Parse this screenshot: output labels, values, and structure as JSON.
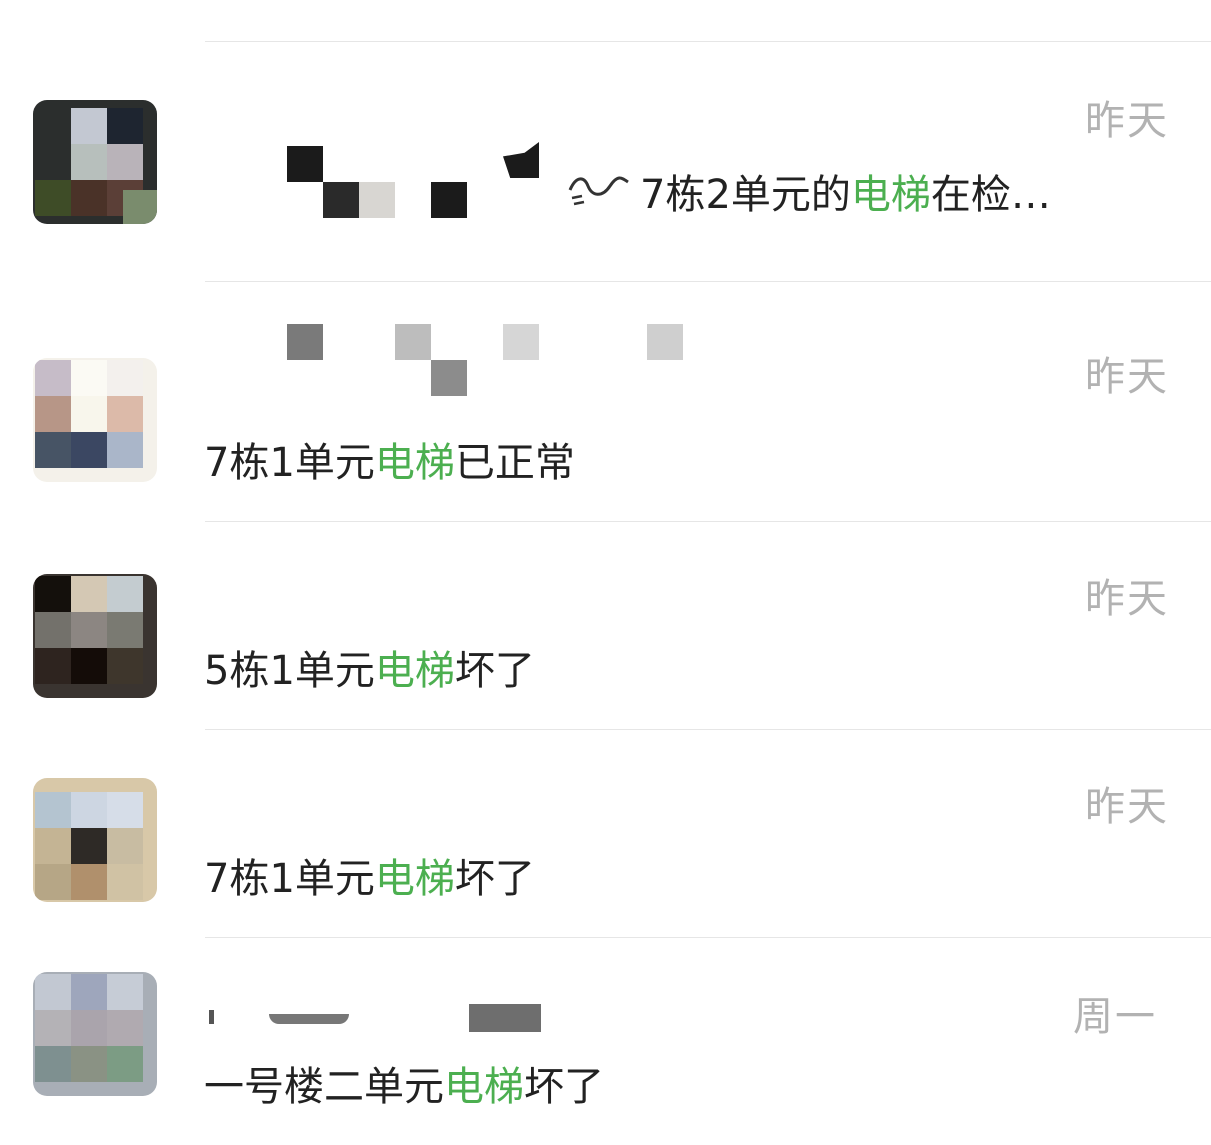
{
  "colors": {
    "keyword": "#4caf50",
    "time": "#b2b2b2",
    "text": "#222222"
  },
  "results": [
    {
      "time": "昨天",
      "preview_pre": "7栋2单元的",
      "keyword": "电梯",
      "preview_post": "在检…"
    },
    {
      "time": "昨天",
      "preview_pre": "7栋1单元",
      "keyword": "电梯",
      "preview_post": "已正常"
    },
    {
      "time": "昨天",
      "preview_pre": "5栋1单元",
      "keyword": "电梯",
      "preview_post": "坏了"
    },
    {
      "time": "昨天",
      "preview_pre": "7栋1单元",
      "keyword": "电梯",
      "preview_post": "坏了"
    },
    {
      "time": "周一",
      "preview_pre": "一号楼二单元",
      "keyword": "电梯",
      "preview_post": "坏了"
    }
  ]
}
